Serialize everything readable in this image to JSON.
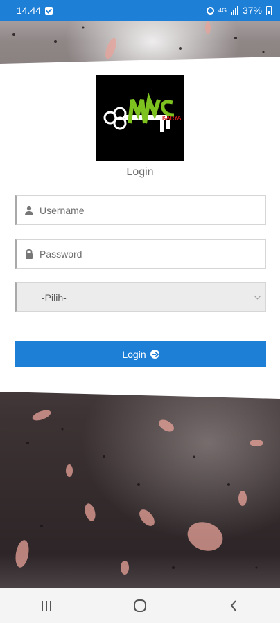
{
  "status_bar": {
    "time": "14.44",
    "network": "4G",
    "battery": "37%"
  },
  "logo": {
    "badge_text": "KARYA"
  },
  "login_form": {
    "title": "Login",
    "username_placeholder": "Username",
    "password_placeholder": "Password",
    "select_value": "-Pilih-",
    "submit_label": "Login"
  },
  "colors": {
    "primary": "#1e7fd6",
    "logo_green": "#7dc21e",
    "logo_red": "#d21e1e"
  },
  "nav_bar": {
    "recents_icon": "recents-icon",
    "home_icon": "home-icon",
    "back_icon": "back-icon"
  }
}
